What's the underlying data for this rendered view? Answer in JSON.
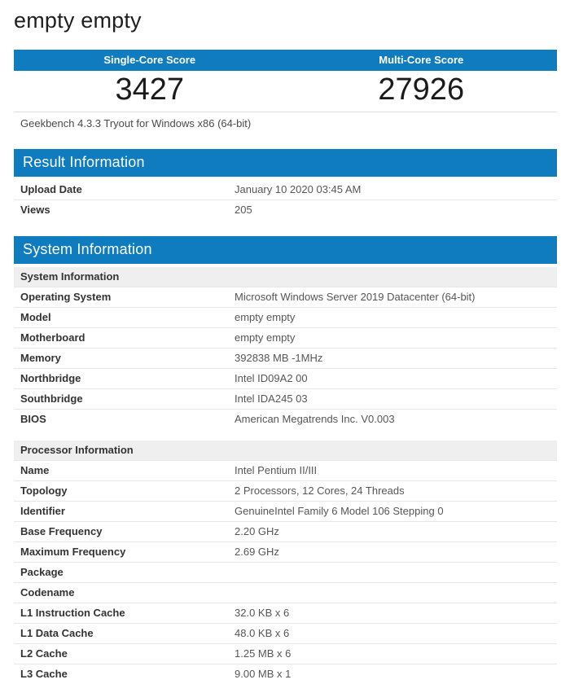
{
  "colors": {
    "accent_blue": "#0e7cbf",
    "subheader_gray": "#efefef",
    "row_border": "#e7e7e7"
  },
  "page": {
    "title": "empty empty"
  },
  "scores": {
    "columns": [
      {
        "label": "Single-Core Score",
        "value": "3427"
      },
      {
        "label": "Multi-Core Score",
        "value": "27926"
      }
    ],
    "caption": "Geekbench 4.3.3 Tryout for Windows x86 (64-bit)"
  },
  "result_information": {
    "title": "Result Information",
    "rows": [
      {
        "label": "Upload Date",
        "value": "January 10 2020 03:45 AM"
      },
      {
        "label": "Views",
        "value": "205"
      }
    ]
  },
  "system_information": {
    "title": "System Information",
    "groups": [
      {
        "heading": "System Information",
        "rows": [
          {
            "label": "Operating System",
            "value": "Microsoft Windows Server 2019 Datacenter (64-bit)"
          },
          {
            "label": "Model",
            "value": "empty empty"
          },
          {
            "label": "Motherboard",
            "value": "empty empty"
          },
          {
            "label": "Memory",
            "value": "392838 MB -1MHz"
          },
          {
            "label": "Northbridge",
            "value": "Intel ID09A2 00"
          },
          {
            "label": "Southbridge",
            "value": "Intel IDA245 03"
          },
          {
            "label": "BIOS",
            "value": "American Megatrends Inc. V0.003"
          }
        ]
      },
      {
        "heading": "Processor Information",
        "rows": [
          {
            "label": "Name",
            "value": "Intel Pentium II/III"
          },
          {
            "label": "Topology",
            "value": "2 Processors, 12 Cores, 24 Threads"
          },
          {
            "label": "Identifier",
            "value": "GenuineIntel Family 6 Model 106 Stepping 0"
          },
          {
            "label": "Base Frequency",
            "value": "2.20 GHz"
          },
          {
            "label": "Maximum Frequency",
            "value": "2.69 GHz"
          },
          {
            "label": "Package",
            "value": ""
          },
          {
            "label": "Codename",
            "value": ""
          },
          {
            "label": "L1 Instruction Cache",
            "value": "32.0 KB x 6"
          },
          {
            "label": "L1 Data Cache",
            "value": "48.0 KB x 6"
          },
          {
            "label": "L2 Cache",
            "value": "1.25 MB x 6"
          },
          {
            "label": "L3 Cache",
            "value": "9.00 MB x 1"
          }
        ]
      }
    ]
  }
}
